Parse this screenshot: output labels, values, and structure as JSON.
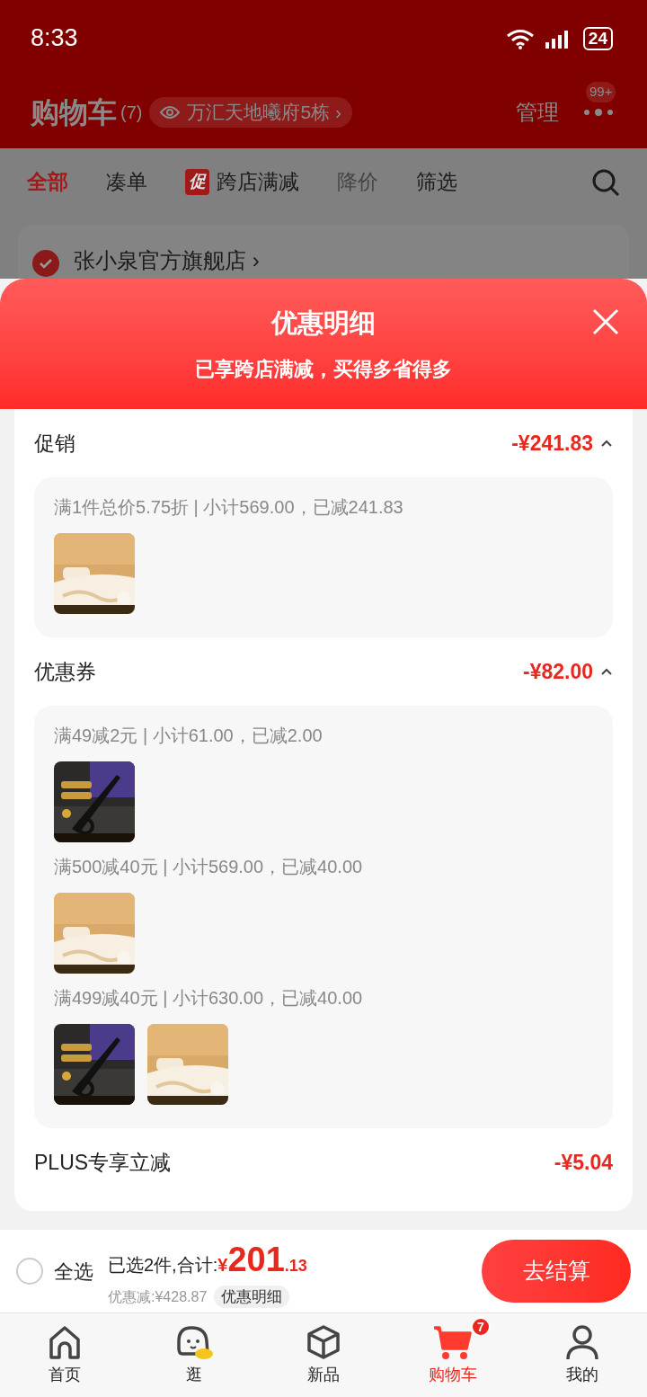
{
  "status_bar": {
    "time": "8:33",
    "battery": "24"
  },
  "header": {
    "title": "购物车",
    "count": "(7)",
    "address": "万汇天地曦府5栋",
    "address_arrow": "›",
    "manage": "管理",
    "more_badge": "99+"
  },
  "filter_tabs": [
    {
      "label": "全部",
      "selected": true,
      "kind": "text"
    },
    {
      "label": "凑单",
      "selected": false,
      "kind": "text"
    },
    {
      "label": "跨店满减",
      "selected": false,
      "kind": "promo",
      "tag": "促"
    },
    {
      "label": "降价",
      "selected": false,
      "kind": "muted"
    },
    {
      "label": "筛选",
      "selected": false,
      "kind": "text"
    }
  ],
  "store": {
    "name": "张小泉官方旗舰店",
    "arrow": "›",
    "checked": true
  },
  "sheet": {
    "title": "优惠明细",
    "subtitle": "已享跨店满减，买得多省得多",
    "sections": [
      {
        "title": "促销",
        "amount": "-¥241.83",
        "expanded": true,
        "rules": [
          {
            "text": "满1件总价5.75折 | 小计569.00，已减241.83"
          }
        ]
      },
      {
        "title": "优惠券",
        "amount": "-¥82.00",
        "expanded": true,
        "rules": [
          {
            "text": "满49减2元 | 小计61.00，已减2.00"
          },
          {
            "text": "满500减40元 | 小计569.00，已减40.00"
          },
          {
            "text": "满499减40元 | 小计630.00，已减40.00"
          }
        ]
      },
      {
        "title": "PLUS专享立减",
        "amount": "-¥5.04"
      }
    ]
  },
  "checkout_bar": {
    "select_all": "全选",
    "select_all_checked": false,
    "summary": "已选2件,合计:",
    "currency": "¥",
    "total_int": "201",
    "total_dec": ".13",
    "discount": "优惠减:¥428.87",
    "detail_button": "优惠明细",
    "checkout_button": "去结算"
  },
  "bottom_nav": [
    {
      "label": "首页",
      "selected": false
    },
    {
      "label": "逛",
      "selected": false
    },
    {
      "label": "新品",
      "selected": false
    },
    {
      "label": "购物车",
      "selected": true,
      "badge": "7"
    },
    {
      "label": "我的",
      "selected": false
    }
  ]
}
